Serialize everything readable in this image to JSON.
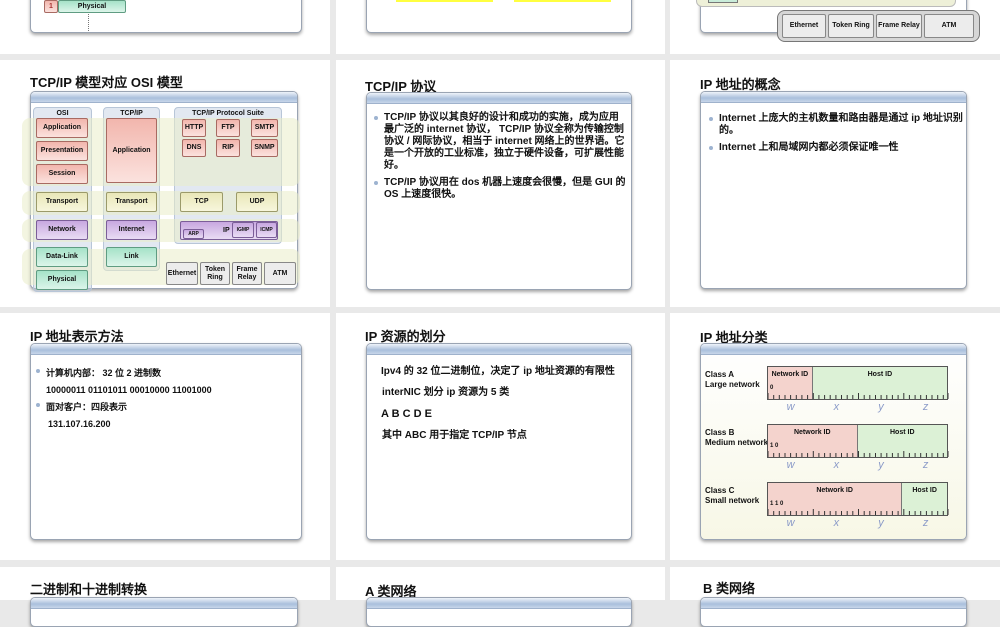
{
  "top_row": {
    "slide1": {
      "layer_num": "1",
      "layer": "Physical"
    },
    "slide3": {
      "link": [
        "Ethernet",
        "Token Ring",
        "Frame Relay",
        "ATM"
      ]
    }
  },
  "slides": {
    "tcpip_osi": {
      "title": "TCP/IP  模型对应  OSI  模型",
      "osi_head": "OSI",
      "osi": [
        "Application",
        "Presentation",
        "Session",
        "Transport",
        "Network",
        "Data-Link",
        "Physical"
      ],
      "tcp_head": "TCP/IP",
      "tcp": [
        "Application",
        "Transport",
        "Internet",
        "Link"
      ],
      "suite_head": "TCP/IP Protocol Suite",
      "app_protos": [
        "HTTP",
        "FTP",
        "SMTP",
        "DNS",
        "RIP",
        "SNMP"
      ],
      "transport": [
        "TCP",
        "UDP"
      ],
      "ip": "IP",
      "arp": "ARP",
      "igmp": "IGMP",
      "icmp": "ICMP",
      "link": [
        "Ethernet",
        "Token Ring",
        "Frame Relay",
        "ATM"
      ]
    },
    "tcpip_proto": {
      "title": "TCP/IP 协议",
      "bullets": [
        "TCP/IP 协议以其良好的设计和成功的实施，成为应用最广泛的 internet 协议， TCP/IP 协议全称为传输控制协议 / 网际协议，相当于 internet 网络上的世界语。它是一个开放的工业标准，独立于硬件设备，可扩展性能好。",
        "TCP/IP 协议用在 dos 机器上速度会很慢，但是 GUI 的 OS 上速度很快。"
      ]
    },
    "ip_concept": {
      "title": "IP 地址的概念",
      "bullets": [
        "Internet 上庞大的主机数量和路由器是通过 ip 地址识别的。",
        "Internet 上和局域网内都必须保证唯一性"
      ]
    },
    "ip_repr": {
      "title": "IP 地址表示方法",
      "b1": "计算机内部： 32 位 2 进制数",
      "binary": "10000011 01101011 00010000 11001000",
      "b2": "面对客户：四段表示",
      "dotted": "131.107.16.200"
    },
    "ip_alloc": {
      "title": "IP 资源的划分",
      "b1": "Ipv4 的 32 位二进制位，决定了 ip 地址资源的有限性",
      "l1": "interNIC 划分 ip 资源为 5 类",
      "b2": "A B C D E",
      "l2": "其中 ABC 用于指定 TCP/IP 节点"
    },
    "ip_class": {
      "title": "IP  地址分类",
      "net": "Network ID",
      "host": "Host ID",
      "letters": [
        "w",
        "x",
        "y",
        "z"
      ],
      "classes": [
        {
          "name": "Class A",
          "desc": "Large network",
          "bits": "0",
          "net_octets": 1
        },
        {
          "name": "Class B",
          "desc": "Medium network",
          "bits": "1 0",
          "net_octets": 2
        },
        {
          "name": "Class C",
          "desc": "Small network",
          "bits": "1 1 0",
          "net_octets": 3
        }
      ]
    },
    "bin_dec": {
      "title": "二进制和十进制转换"
    },
    "class_a": {
      "title": "A 类网络"
    },
    "class_b": {
      "title": "B 类网络"
    }
  }
}
